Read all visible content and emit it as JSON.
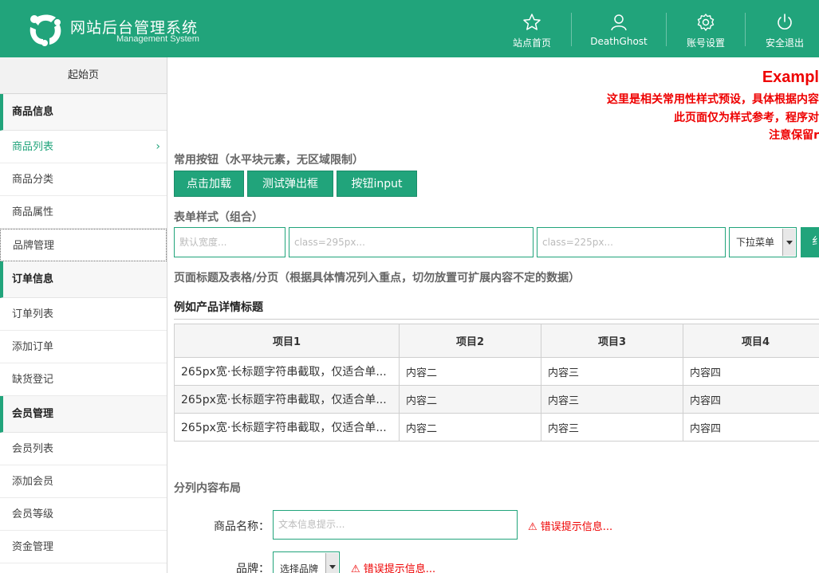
{
  "header": {
    "title": "网站后台管理系统",
    "subtitle": "Management System",
    "nav": [
      {
        "label": "站点首页",
        "icon": "star-icon"
      },
      {
        "label": "DeathGhost",
        "icon": "user-icon"
      },
      {
        "label": "账号设置",
        "icon": "gear-icon"
      },
      {
        "label": "安全退出",
        "icon": "power-icon"
      }
    ]
  },
  "sidebar": {
    "start": "起始页",
    "groups": [
      {
        "title": "商品信息",
        "items": [
          "商品列表",
          "商品分类",
          "商品属性",
          "品牌管理"
        ]
      },
      {
        "title": "订单信息",
        "items": [
          "订单列表",
          "添加订单",
          "缺货登记"
        ]
      },
      {
        "title": "会员管理",
        "items": [
          "会员列表",
          "添加会员",
          "会员等级",
          "资金管理"
        ]
      }
    ]
  },
  "main": {
    "example_title": "Exampl",
    "example_lines": [
      "这里是相关常用性样式预设，具体根据内容",
      "此页面仅为样式参考，程序对",
      "注意保留r"
    ],
    "buttons_title": "常用按钮（水平块元素，无区域限制）",
    "buttons": [
      "点击加载",
      "测试弹出框",
      "按钮input"
    ],
    "form_title": "表单样式（组合）",
    "inputs": [
      "默认宽度...",
      "class=295px...",
      "class=225px..."
    ],
    "select_value": "下拉菜单",
    "go_button": "纟",
    "table_section_title": "页面标题及表格/分页（根据具体情况列入重点，切勿放置可扩展内容不定的数据）",
    "detail_title": "例如产品详情标题",
    "table": {
      "headers": [
        "项目1",
        "项目2",
        "项目3",
        "项目4"
      ],
      "rows": [
        [
          "265px宽·长标题字符串截取，仅适合单...",
          "内容二",
          "内容三",
          "内容四"
        ],
        [
          "265px宽·长标题字符串截取，仅适合单...",
          "内容二",
          "内容三",
          "内容四"
        ],
        [
          "265px宽·长标题字符串截取，仅适合单...",
          "内容二",
          "内容三",
          "内容四"
        ]
      ]
    },
    "columns_title": "分列内容布局",
    "form": {
      "name_label": "商品名称：",
      "name_placeholder": "文本信息提示...",
      "name_error": "⚠ 错误提示信息...",
      "brand_label": "品牌：",
      "brand_value": "选择品牌",
      "brand_error": "⚠ 错误提示信息..."
    }
  },
  "colors": {
    "primary": "#21a47b",
    "error": "#e00000"
  }
}
